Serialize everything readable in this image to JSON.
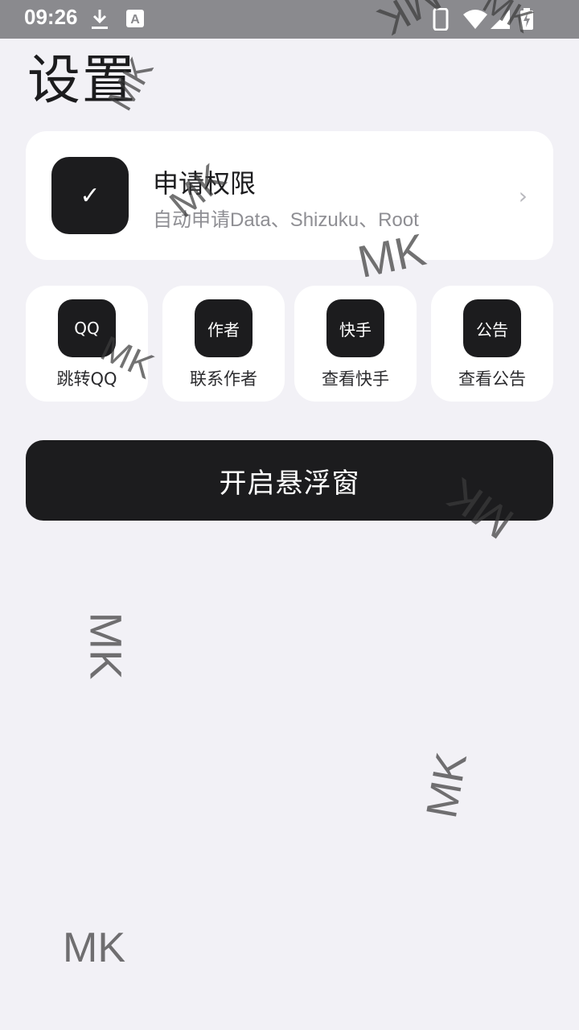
{
  "status_bar": {
    "time": "09:26",
    "icons": [
      "download-icon",
      "keyboard-a-icon",
      "phone-icon",
      "wifi-icon",
      "signal-icon",
      "battery-charging-icon"
    ]
  },
  "page": {
    "title": "设置"
  },
  "permission_card": {
    "title": "申请权限",
    "subtitle": "自动申请Data、Shizuku、Root",
    "icon_glyph": "✓",
    "chevron": "›"
  },
  "shortcuts": [
    {
      "icon_text": "QQ",
      "label": "跳转QQ"
    },
    {
      "icon_text": "作者",
      "label": "联系作者"
    },
    {
      "icon_text": "快手",
      "label": "查看快手"
    },
    {
      "icon_text": "公告",
      "label": "查看公告"
    }
  ],
  "float_button": {
    "label": "开启悬浮窗"
  },
  "watermark": {
    "text": "MK"
  }
}
